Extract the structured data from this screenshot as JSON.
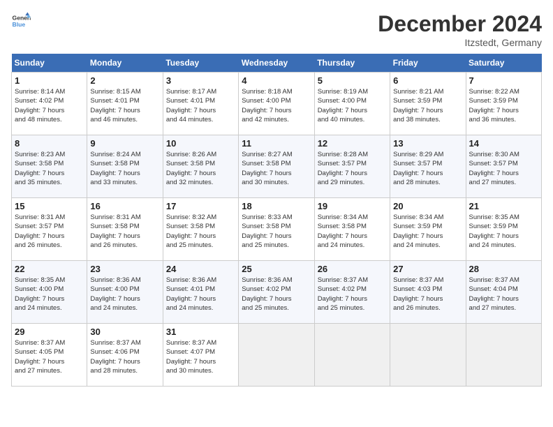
{
  "header": {
    "logo_line1": "General",
    "logo_line2": "Blue",
    "title": "December 2024",
    "subtitle": "Itzstedt, Germany"
  },
  "days_of_week": [
    "Sunday",
    "Monday",
    "Tuesday",
    "Wednesday",
    "Thursday",
    "Friday",
    "Saturday"
  ],
  "weeks": [
    [
      {
        "day": "1",
        "info": "Sunrise: 8:14 AM\nSunset: 4:02 PM\nDaylight: 7 hours\nand 48 minutes."
      },
      {
        "day": "2",
        "info": "Sunrise: 8:15 AM\nSunset: 4:01 PM\nDaylight: 7 hours\nand 46 minutes."
      },
      {
        "day": "3",
        "info": "Sunrise: 8:17 AM\nSunset: 4:01 PM\nDaylight: 7 hours\nand 44 minutes."
      },
      {
        "day": "4",
        "info": "Sunrise: 8:18 AM\nSunset: 4:00 PM\nDaylight: 7 hours\nand 42 minutes."
      },
      {
        "day": "5",
        "info": "Sunrise: 8:19 AM\nSunset: 4:00 PM\nDaylight: 7 hours\nand 40 minutes."
      },
      {
        "day": "6",
        "info": "Sunrise: 8:21 AM\nSunset: 3:59 PM\nDaylight: 7 hours\nand 38 minutes."
      },
      {
        "day": "7",
        "info": "Sunrise: 8:22 AM\nSunset: 3:59 PM\nDaylight: 7 hours\nand 36 minutes."
      }
    ],
    [
      {
        "day": "8",
        "info": "Sunrise: 8:23 AM\nSunset: 3:58 PM\nDaylight: 7 hours\nand 35 minutes."
      },
      {
        "day": "9",
        "info": "Sunrise: 8:24 AM\nSunset: 3:58 PM\nDaylight: 7 hours\nand 33 minutes."
      },
      {
        "day": "10",
        "info": "Sunrise: 8:26 AM\nSunset: 3:58 PM\nDaylight: 7 hours\nand 32 minutes."
      },
      {
        "day": "11",
        "info": "Sunrise: 8:27 AM\nSunset: 3:58 PM\nDaylight: 7 hours\nand 30 minutes."
      },
      {
        "day": "12",
        "info": "Sunrise: 8:28 AM\nSunset: 3:57 PM\nDaylight: 7 hours\nand 29 minutes."
      },
      {
        "day": "13",
        "info": "Sunrise: 8:29 AM\nSunset: 3:57 PM\nDaylight: 7 hours\nand 28 minutes."
      },
      {
        "day": "14",
        "info": "Sunrise: 8:30 AM\nSunset: 3:57 PM\nDaylight: 7 hours\nand 27 minutes."
      }
    ],
    [
      {
        "day": "15",
        "info": "Sunrise: 8:31 AM\nSunset: 3:57 PM\nDaylight: 7 hours\nand 26 minutes."
      },
      {
        "day": "16",
        "info": "Sunrise: 8:31 AM\nSunset: 3:58 PM\nDaylight: 7 hours\nand 26 minutes."
      },
      {
        "day": "17",
        "info": "Sunrise: 8:32 AM\nSunset: 3:58 PM\nDaylight: 7 hours\nand 25 minutes."
      },
      {
        "day": "18",
        "info": "Sunrise: 8:33 AM\nSunset: 3:58 PM\nDaylight: 7 hours\nand 25 minutes."
      },
      {
        "day": "19",
        "info": "Sunrise: 8:34 AM\nSunset: 3:58 PM\nDaylight: 7 hours\nand 24 minutes."
      },
      {
        "day": "20",
        "info": "Sunrise: 8:34 AM\nSunset: 3:59 PM\nDaylight: 7 hours\nand 24 minutes."
      },
      {
        "day": "21",
        "info": "Sunrise: 8:35 AM\nSunset: 3:59 PM\nDaylight: 7 hours\nand 24 minutes."
      }
    ],
    [
      {
        "day": "22",
        "info": "Sunrise: 8:35 AM\nSunset: 4:00 PM\nDaylight: 7 hours\nand 24 minutes."
      },
      {
        "day": "23",
        "info": "Sunrise: 8:36 AM\nSunset: 4:00 PM\nDaylight: 7 hours\nand 24 minutes."
      },
      {
        "day": "24",
        "info": "Sunrise: 8:36 AM\nSunset: 4:01 PM\nDaylight: 7 hours\nand 24 minutes."
      },
      {
        "day": "25",
        "info": "Sunrise: 8:36 AM\nSunset: 4:02 PM\nDaylight: 7 hours\nand 25 minutes."
      },
      {
        "day": "26",
        "info": "Sunrise: 8:37 AM\nSunset: 4:02 PM\nDaylight: 7 hours\nand 25 minutes."
      },
      {
        "day": "27",
        "info": "Sunrise: 8:37 AM\nSunset: 4:03 PM\nDaylight: 7 hours\nand 26 minutes."
      },
      {
        "day": "28",
        "info": "Sunrise: 8:37 AM\nSunset: 4:04 PM\nDaylight: 7 hours\nand 27 minutes."
      }
    ],
    [
      {
        "day": "29",
        "info": "Sunrise: 8:37 AM\nSunset: 4:05 PM\nDaylight: 7 hours\nand 27 minutes."
      },
      {
        "day": "30",
        "info": "Sunrise: 8:37 AM\nSunset: 4:06 PM\nDaylight: 7 hours\nand 28 minutes."
      },
      {
        "day": "31",
        "info": "Sunrise: 8:37 AM\nSunset: 4:07 PM\nDaylight: 7 hours\nand 30 minutes."
      },
      {
        "day": "",
        "info": ""
      },
      {
        "day": "",
        "info": ""
      },
      {
        "day": "",
        "info": ""
      },
      {
        "day": "",
        "info": ""
      }
    ]
  ]
}
